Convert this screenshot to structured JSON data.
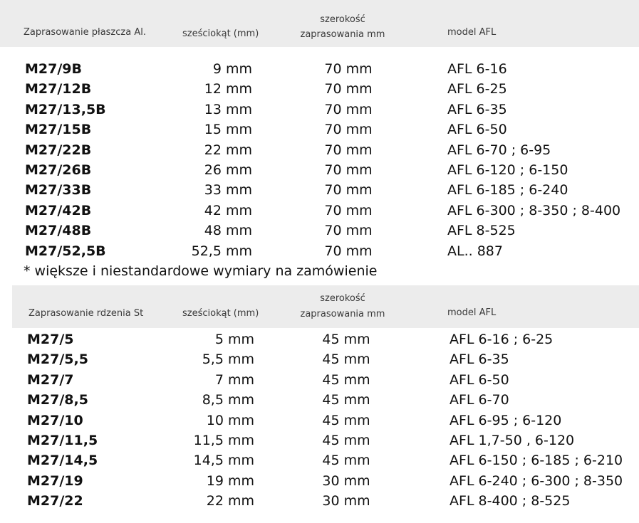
{
  "section1": {
    "headers": {
      "name": "Zaprasowanie płaszcza Al.",
      "hex": "sześciokąt (mm)",
      "width_line1": "szerokość",
      "width_line2": "zaprasowania mm",
      "model": "model AFL"
    },
    "rows": [
      {
        "code": "M27/9B",
        "hex": "9 mm",
        "width": "70 mm",
        "model": "AFL 6-16"
      },
      {
        "code": "M27/12B",
        "hex": "12 mm",
        "width": "70 mm",
        "model": "AFL 6-25"
      },
      {
        "code": "M27/13,5B",
        "hex": "13 mm",
        "width": "70 mm",
        "model": "AFL 6-35"
      },
      {
        "code": "M27/15B",
        "hex": "15 mm",
        "width": "70 mm",
        "model": "AFL 6-50"
      },
      {
        "code": "M27/22B",
        "hex": "22 mm",
        "width": "70 mm",
        "model": "AFL 6-70 ; 6-95"
      },
      {
        "code": "M27/26B",
        "hex": "26 mm",
        "width": "70 mm",
        "model": "AFL 6-120 ; 6-150"
      },
      {
        "code": "M27/33B",
        "hex": "33 mm",
        "width": "70 mm",
        "model": "AFL 6-185 ; 6-240"
      },
      {
        "code": "M27/42B",
        "hex": "42 mm",
        "width": "70 mm",
        "model": "AFL 6-300 ; 8-350 ; 8-400"
      },
      {
        "code": "M27/48B",
        "hex": "48 mm",
        "width": "70 mm",
        "model": "AFL 8-525"
      },
      {
        "code": "M27/52,5B",
        "hex": "52,5 mm",
        "width": "70 mm",
        "model": "AL.. 887"
      }
    ],
    "note": "* większe i niestandardowe wymiary na zamówienie"
  },
  "section2": {
    "headers": {
      "name": "Zaprasowanie rdzenia St",
      "hex": "sześciokąt (mm)",
      "width_line1": "szerokość",
      "width_line2": "zaprasowania mm",
      "model": "model AFL"
    },
    "rows": [
      {
        "code": "M27/5",
        "hex": "5 mm",
        "width": "45 mm",
        "model": "AFL 6-16 ; 6-25"
      },
      {
        "code": "M27/5,5",
        "hex": "5,5 mm",
        "width": "45 mm",
        "model": "AFL 6-35"
      },
      {
        "code": "M27/7",
        "hex": "7 mm",
        "width": "45 mm",
        "model": "AFL 6-50"
      },
      {
        "code": "M27/8,5",
        "hex": "8,5 mm",
        "width": "45 mm",
        "model": "AFL 6-70"
      },
      {
        "code": "M27/10",
        "hex": "10 mm",
        "width": "45 mm",
        "model": "AFL 6-95 ; 6-120"
      },
      {
        "code": "M27/11,5",
        "hex": "11,5 mm",
        "width": "45 mm",
        "model": "AFL 1,7-50 , 6-120"
      },
      {
        "code": "M27/14,5",
        "hex": "14,5 mm",
        "width": "45 mm",
        "model": "AFL 6-150 ; 6-185 ; 6-210"
      },
      {
        "code": "M27/19",
        "hex": "19 mm",
        "width": "30 mm",
        "model": "AFL 6-240 ; 6-300 ; 8-350"
      },
      {
        "code": "M27/22",
        "hex": "22 mm",
        "width": "30 mm",
        "model": "AFL 8-400 ; 8-525"
      }
    ]
  },
  "colors": {
    "header_band": "#ececec",
    "text": "#111111",
    "header_text": "#3a3a3a"
  }
}
